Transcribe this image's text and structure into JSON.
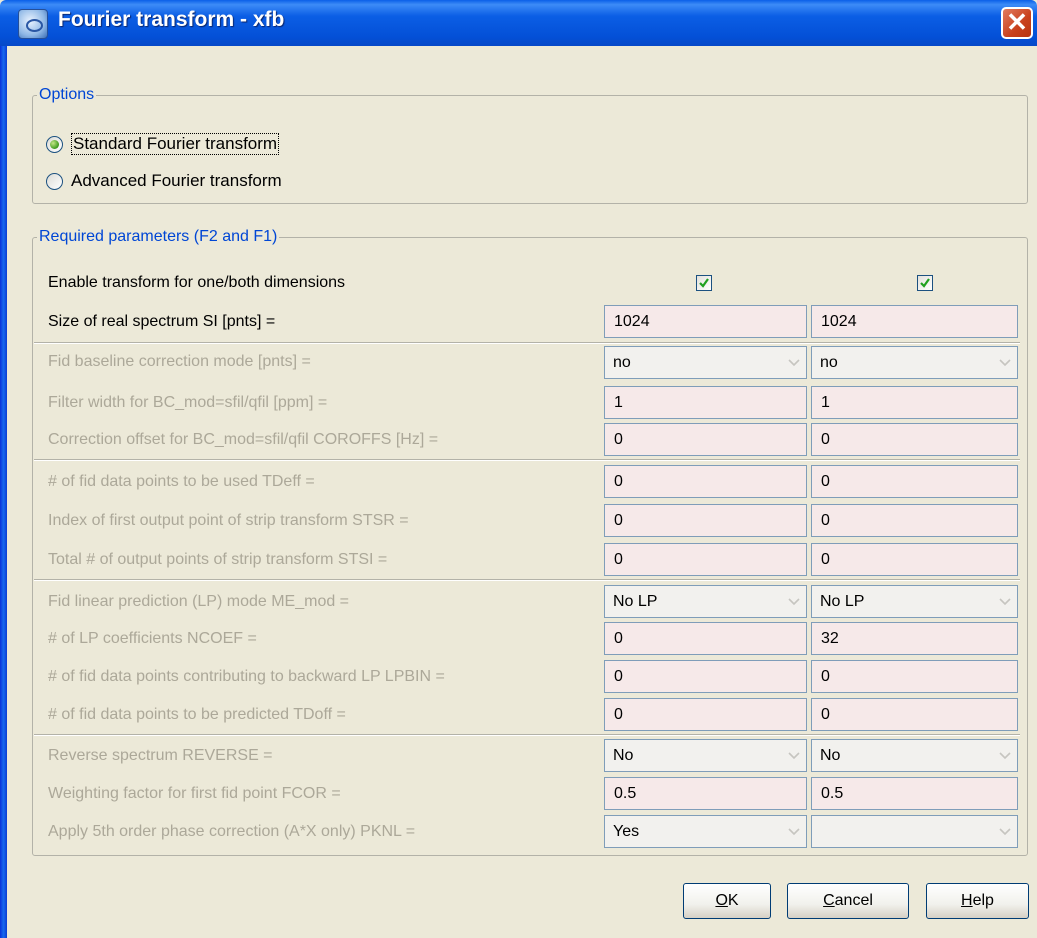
{
  "window": {
    "title": "Fourier transform - xfb",
    "close_label": "✕"
  },
  "options": {
    "legend": "Options",
    "items": [
      {
        "label": "Standard Fourier transform",
        "checked": true
      },
      {
        "label": "Advanced Fourier transform",
        "checked": false
      }
    ]
  },
  "required": {
    "legend": "Required parameters (F2 and F1)",
    "enable_label": "Enable transform for one/both dimensions",
    "enable_f2": true,
    "enable_f1": true,
    "rows": [
      {
        "label": "Size of real spectrum SI [pnts] =",
        "f2": "1024",
        "f1": "1024"
      },
      {
        "label": "Fid baseline correction mode [pnts] =",
        "f2": "no",
        "f1": "no"
      },
      {
        "label": "Filter width for BC_mod=sfil/qfil [ppm] =",
        "f2": "1",
        "f1": "1"
      },
      {
        "label": "Correction offset for BC_mod=sfil/qfil COROFFS [Hz] =",
        "f2": "0",
        "f1": "0"
      },
      {
        "label": "# of fid data points to be used TDeff =",
        "f2": "0",
        "f1": "0"
      },
      {
        "label": "Index of first output point of strip transform STSR =",
        "f2": "0",
        "f1": "0"
      },
      {
        "label": "Total # of output points of strip transform STSI =",
        "f2": "0",
        "f1": "0"
      },
      {
        "label": "Fid linear prediction (LP) mode ME_mod =",
        "f2": "No LP",
        "f1": "No LP"
      },
      {
        "label": "# of LP coefficients NCOEF =",
        "f2": "0",
        "f1": "32"
      },
      {
        "label": "# of fid data points contributing to backward LP LPBIN =",
        "f2": "0",
        "f1": "0"
      },
      {
        "label": "# of fid data points to be predicted TDoff =",
        "f2": "0",
        "f1": "0"
      },
      {
        "label": "Reverse spectrum REVERSE =",
        "f2": "No",
        "f1": "No"
      },
      {
        "label": "Weighting factor for first fid point FCOR =",
        "f2": "0.5",
        "f1": "0.5"
      },
      {
        "label": "Apply 5th order phase correction (A*X only) PKNL =",
        "f2": "Yes",
        "f1": ""
      }
    ]
  },
  "buttons": {
    "ok": {
      "mnemonic": "O",
      "rest": "K"
    },
    "cancel": {
      "mnemonic": "C",
      "rest": "ancel"
    },
    "help": {
      "mnemonic": "H",
      "rest": "elp"
    }
  },
  "colors": {
    "title_bar": "#0450d7",
    "legend": "#0046d5",
    "field_bg": "#f6e9e9",
    "disabled_text": "#aca899"
  }
}
